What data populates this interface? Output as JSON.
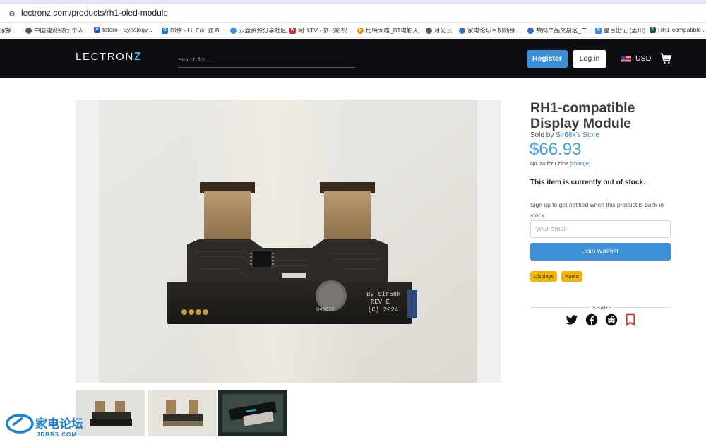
{
  "browser": {
    "url": "lectronz.com/products/rh1-oled-module",
    "bookmarks": [
      {
        "label": "家摸...",
        "icon": "",
        "color": "#ffffff"
      },
      {
        "label": "中国建设银行 个人...",
        "icon": "globe-icon",
        "color": "#555555"
      },
      {
        "label": "totoro - Synology...",
        "icon": "synology-icon",
        "color": "#1e5bb8"
      },
      {
        "label": "邮件 - Li, Eric @ B...",
        "icon": "outlook-icon",
        "color": "#1f6fc5"
      },
      {
        "label": "云盘资源分享社区",
        "icon": "cloud-icon",
        "color": "#3a8ee6"
      },
      {
        "label": "网飞TV - 奈飞影视...",
        "icon": "netflix-icon",
        "color": "#d62828"
      },
      {
        "label": "比特大雄_BT电影天...",
        "icon": "play-icon",
        "color": "#f08c00"
      },
      {
        "label": "月光云",
        "icon": "globe-icon",
        "color": "#555555"
      },
      {
        "label": "家电论坛耳机随身...",
        "icon": "ear-icon",
        "color": "#2b6fb6"
      },
      {
        "label": "数码产品交易区_二...",
        "icon": "ear-icon",
        "color": "#2b6fb6"
      },
      {
        "label": "星盲出证 (孟川)",
        "icon": "n-icon",
        "color": "#3b82f6"
      },
      {
        "label": "RH1-compatible...",
        "icon": "lectronz-icon",
        "color": "#1a5f4f"
      }
    ]
  },
  "header": {
    "logo_text": "LECTRON",
    "logo_accent": "Z",
    "search_placeholder": "search for...",
    "register_label": "Register",
    "login_label": "Log in",
    "currency": "USD",
    "cart_icon": "cart-icon"
  },
  "product": {
    "title": "RH1-compatible Display Module",
    "sold_by_prefix": "Sold by ",
    "seller": "Sir68k's Store",
    "price": "$66.93",
    "tax_note": "No tax for China ",
    "tax_change": "[change]",
    "stock_status": "This item is currently out of stock.",
    "notify_text": "Sign up to get notified when this product is back in stock.",
    "email_placeholder": "your email",
    "waitlist_label": "Join waitlist",
    "tags": [
      "Displays",
      "Audio"
    ],
    "share_label": "SHARE",
    "share_icons": [
      "twitter-icon",
      "facebook-icon",
      "reddit-icon",
      "bookmark-icon"
    ],
    "board_text": [
      "By Sir68k",
      "REV E",
      "(C) 2024"
    ],
    "board_code": "048630"
  },
  "colors": {
    "accent": "#3b9de0",
    "button": "#3d8fd8",
    "tag": "#f4b400",
    "nav": "#0c0e12",
    "bookmark_red": "#e0342f"
  },
  "watermark": {
    "cn": "家电论坛",
    "en": "JDBBS.COM"
  }
}
